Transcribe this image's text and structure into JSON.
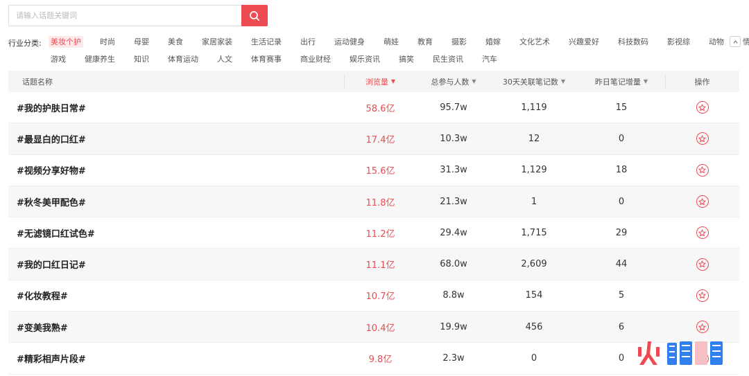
{
  "search": {
    "placeholder": "请输入话题关键词"
  },
  "industry": {
    "label": "行业分类:",
    "row1": [
      "美妆个护",
      "时尚",
      "母婴",
      "美食",
      "家居家装",
      "生活记录",
      "出行",
      "运动健身",
      "萌娃",
      "教育",
      "摄影",
      "婚嫁",
      "文化艺术",
      "兴趣爱好",
      "科技数码",
      "影视综",
      "动物",
      "情感"
    ],
    "row2": [
      "游戏",
      "健康养生",
      "知识",
      "体育运动",
      "人文",
      "体育赛事",
      "商业财经",
      "娱乐资讯",
      "搞笑",
      "民生资讯",
      "汽车"
    ],
    "active": "美妆个护"
  },
  "table": {
    "headers": {
      "name": "话题名称",
      "views": "浏览量",
      "users": "总参与人数",
      "notes": "30天关联笔记数",
      "inc": "昨日笔记增量",
      "op": "操作"
    },
    "rows": [
      {
        "name": "#我的护肤日常#",
        "views": "58.6亿",
        "users": "95.7w",
        "notes": "1,119",
        "inc": "15"
      },
      {
        "name": "#最显白的口红#",
        "views": "17.4亿",
        "users": "10.3w",
        "notes": "12",
        "inc": "0"
      },
      {
        "name": "#视频分享好物#",
        "views": "15.6亿",
        "users": "31.3w",
        "notes": "1,129",
        "inc": "18"
      },
      {
        "name": "#秋冬美甲配色#",
        "views": "11.8亿",
        "users": "21.3w",
        "notes": "1",
        "inc": "0"
      },
      {
        "name": "#无滤镜口红试色#",
        "views": "11.2亿",
        "users": "29.4w",
        "notes": "1,715",
        "inc": "29"
      },
      {
        "name": "#我的口红日记#",
        "views": "11.1亿",
        "users": "68.0w",
        "notes": "2,609",
        "inc": "44"
      },
      {
        "name": "#化妆教程#",
        "views": "10.7亿",
        "users": "8.8w",
        "notes": "154",
        "inc": "5"
      },
      {
        "name": "#变美我熟#",
        "views": "10.4亿",
        "users": "19.9w",
        "notes": "456",
        "inc": "6"
      },
      {
        "name": "#精彩相声片段#",
        "views": "9.8亿",
        "users": "2.3w",
        "notes": "0",
        "inc": "0"
      }
    ]
  },
  "watermark": {
    "text": "火鲤鱼"
  },
  "colors": {
    "accent": "#ee4a52",
    "header_bg": "#f5f5f5",
    "stripe": "#f7f7f7"
  },
  "icons": {
    "search": "search-icon",
    "favorite": "star-circle-icon",
    "collapse": "chevron-up-icon"
  }
}
